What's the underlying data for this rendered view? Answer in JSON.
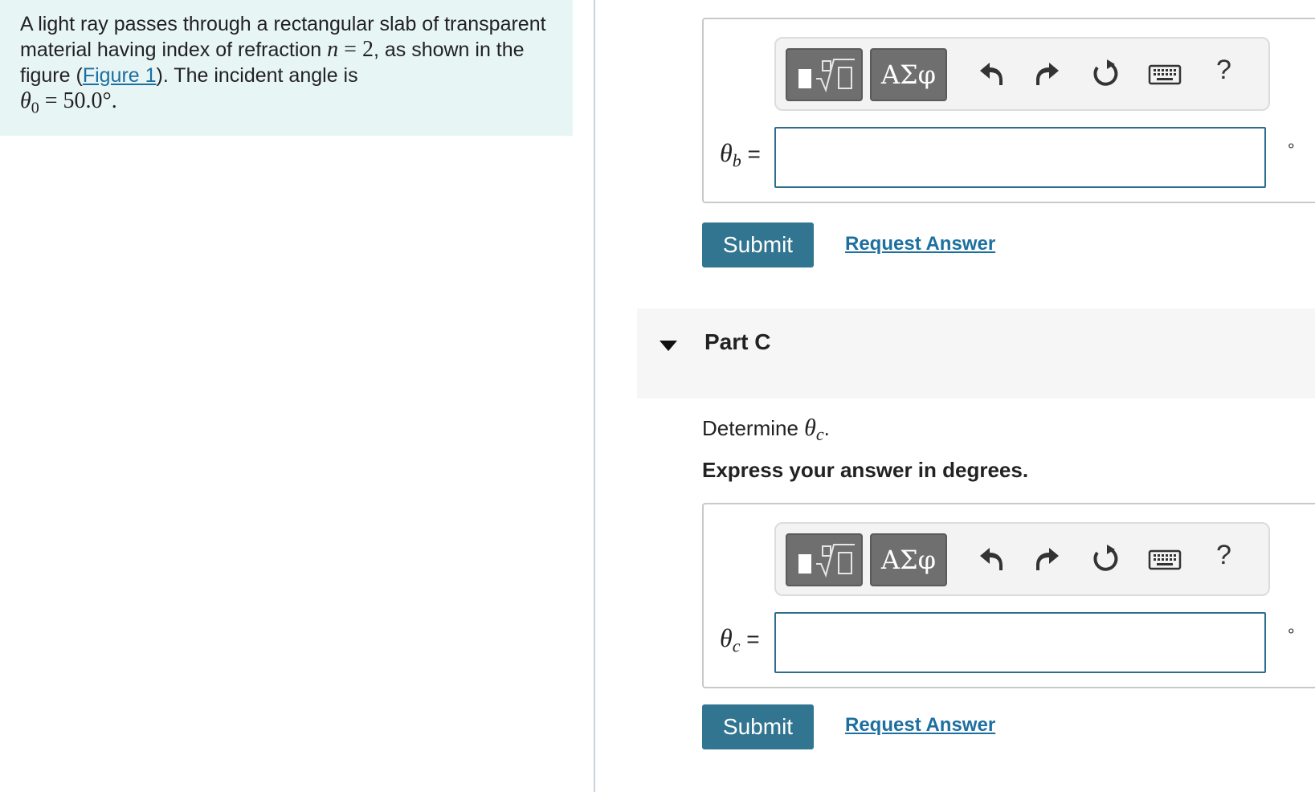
{
  "problem": {
    "text_part1": "A light ray passes through a rectangular slab of transparent material having index of refraction ",
    "n_symbol": "n",
    "n_equals": " = 2",
    "text_part2": ", as shown in the figure (",
    "figure_link": "Figure 1",
    "text_part3": "). The incident angle is ",
    "theta0_symbol": "θ",
    "theta0_sub": "0",
    "theta0_value": " = 50.0°."
  },
  "toolbar": {
    "greek_label": "ΑΣφ",
    "help_label": "?"
  },
  "part_b": {
    "var_symbol": "θ",
    "var_sub": "b",
    "equals": " =",
    "unit": "∘",
    "input_value": "",
    "submit_label": "Submit",
    "request_label": "Request Answer"
  },
  "part_c": {
    "title": "Part C",
    "determine_prefix": "Determine ",
    "determine_symbol": "θ",
    "determine_sub": "c",
    "determine_suffix": ".",
    "instruction": "Express your answer in degrees.",
    "var_symbol": "θ",
    "var_sub": "c",
    "equals": " =",
    "unit": "∘",
    "input_value": "",
    "submit_label": "Submit",
    "request_label": "Request Answer"
  }
}
